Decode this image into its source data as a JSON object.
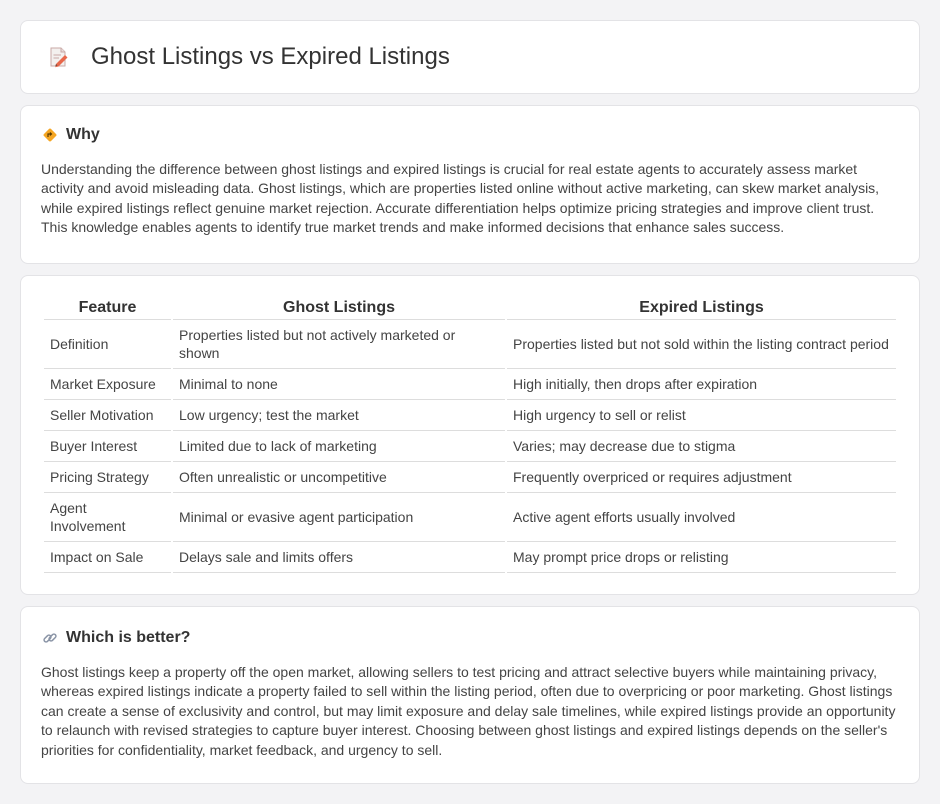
{
  "header": {
    "title": "Ghost Listings vs Expired Listings",
    "icon": "pencil-document-icon"
  },
  "why": {
    "title": "Why",
    "icon": "diamond-sign-icon",
    "text": "Understanding the difference between ghost listings and expired listings is crucial for real estate agents to accurately assess market activity and avoid misleading data. Ghost listings, which are properties listed online without active marketing, can skew market analysis, while expired listings reflect genuine market rejection. Accurate differentiation helps optimize pricing strategies and improve client trust. This knowledge enables agents to identify true market trends and make informed decisions that enhance sales success."
  },
  "table": {
    "headers": [
      "Feature",
      "Ghost Listings",
      "Expired Listings"
    ],
    "rows": [
      [
        "Definition",
        "Properties listed but not actively marketed or shown",
        "Properties listed but not sold within the listing contract period"
      ],
      [
        "Market Exposure",
        "Minimal to none",
        "High initially, then drops after expiration"
      ],
      [
        "Seller Motivation",
        "Low urgency; test the market",
        "High urgency to sell or relist"
      ],
      [
        "Buyer Interest",
        "Limited due to lack of marketing",
        "Varies; may decrease due to stigma"
      ],
      [
        "Pricing Strategy",
        "Often unrealistic or uncompetitive",
        "Frequently overpriced or requires adjustment"
      ],
      [
        "Agent Involvement",
        "Minimal or evasive agent participation",
        "Active agent efforts usually involved"
      ],
      [
        "Impact on Sale",
        "Delays sale and limits offers",
        "May prompt price drops or relisting"
      ]
    ]
  },
  "better": {
    "title": "Which is better?",
    "icon": "link-icon",
    "text": "Ghost listings keep a property off the open market, allowing sellers to test pricing and attract selective buyers while maintaining privacy, whereas expired listings indicate a property failed to sell within the listing period, often due to overpricing or poor marketing. Ghost listings can create a sense of exclusivity and control, but may limit exposure and delay sale timelines, while expired listings provide an opportunity to relaunch with revised strategies to capture buyer interest. Choosing between ghost listings and expired listings depends on the seller's priorities for confidentiality, market feedback, and urgency to sell."
  }
}
